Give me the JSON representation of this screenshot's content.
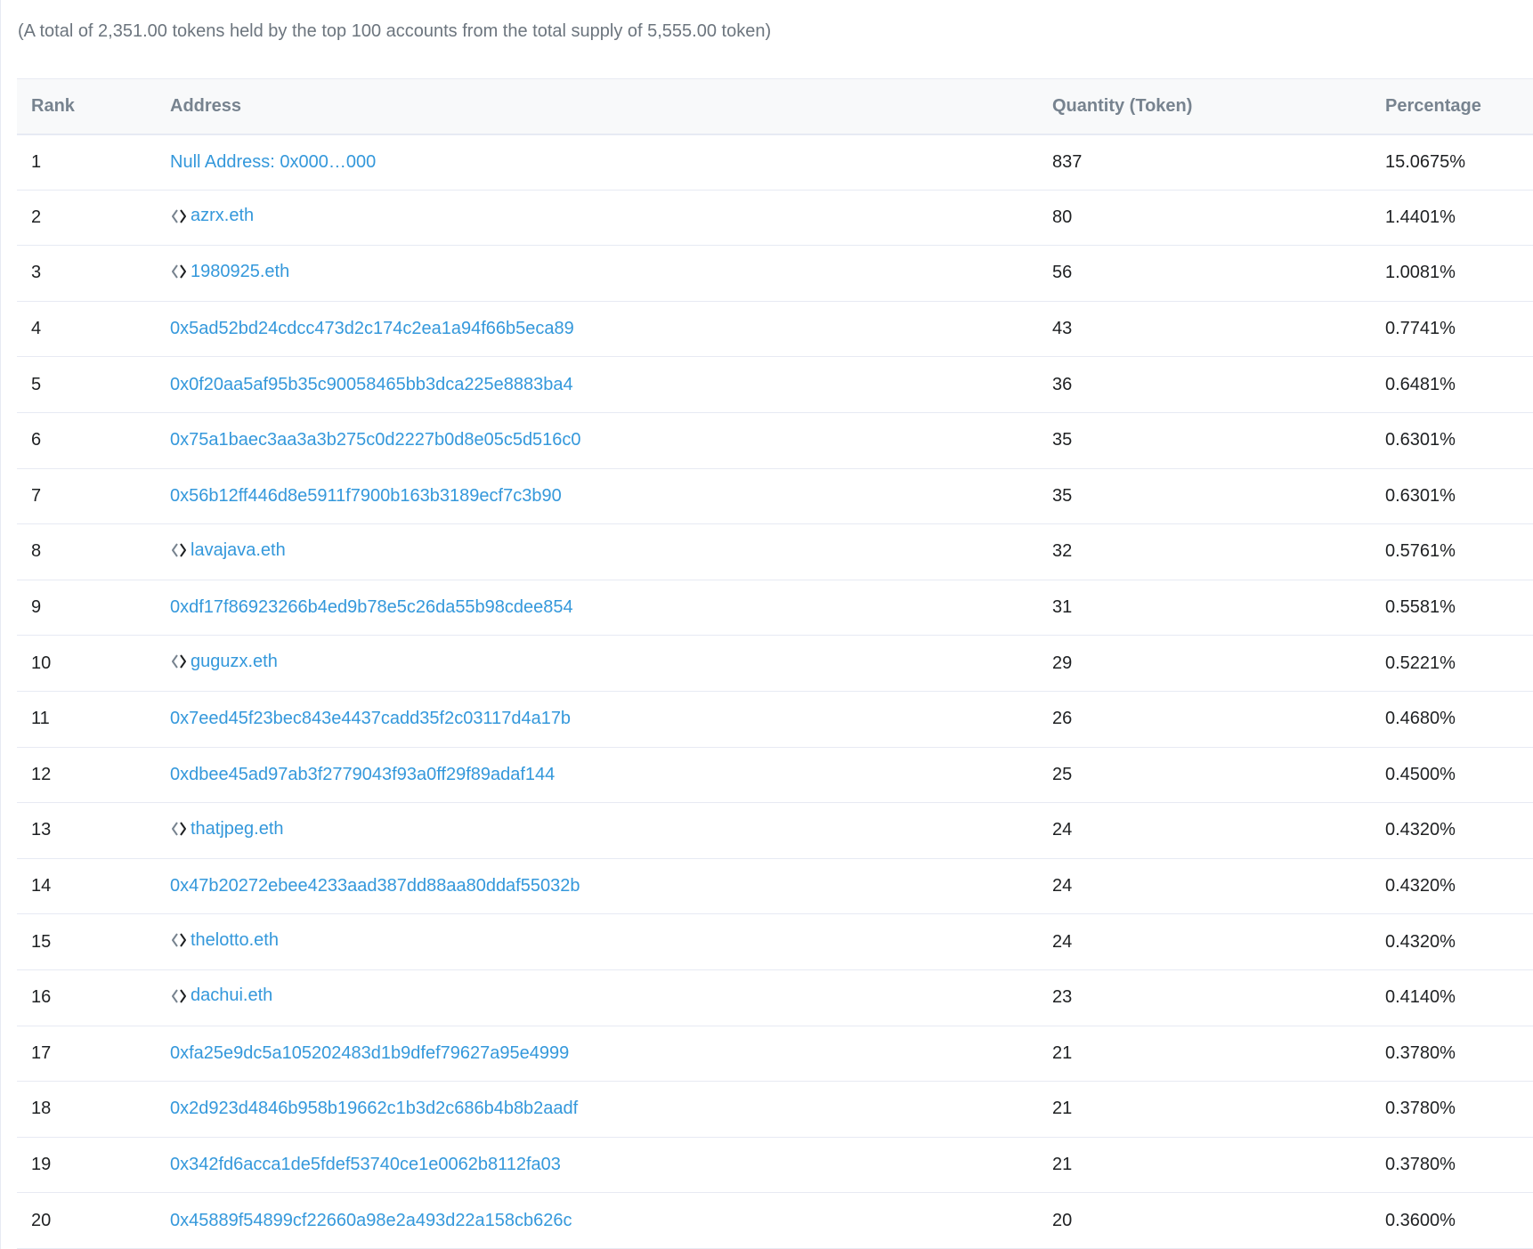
{
  "summary": "(A total of 2,351.00 tokens held by the top 100 accounts from the total supply of 5,555.00 token)",
  "table": {
    "headers": {
      "rank": "Rank",
      "address": "Address",
      "quantity": "Quantity (Token)",
      "percentage": "Percentage"
    },
    "rows": [
      {
        "rank": "1",
        "address": "Null Address: 0x000…000",
        "ens": false,
        "quantity": "837",
        "percentage": "15.0675%"
      },
      {
        "rank": "2",
        "address": "azrx.eth",
        "ens": true,
        "quantity": "80",
        "percentage": "1.4401%"
      },
      {
        "rank": "3",
        "address": "1980925.eth",
        "ens": true,
        "quantity": "56",
        "percentage": "1.0081%"
      },
      {
        "rank": "4",
        "address": "0x5ad52bd24cdcc473d2c174c2ea1a94f66b5eca89",
        "ens": false,
        "quantity": "43",
        "percentage": "0.7741%"
      },
      {
        "rank": "5",
        "address": "0x0f20aa5af95b35c90058465bb3dca225e8883ba4",
        "ens": false,
        "quantity": "36",
        "percentage": "0.6481%"
      },
      {
        "rank": "6",
        "address": "0x75a1baec3aa3a3b275c0d2227b0d8e05c5d516c0",
        "ens": false,
        "quantity": "35",
        "percentage": "0.6301%"
      },
      {
        "rank": "7",
        "address": "0x56b12ff446d8e5911f7900b163b3189ecf7c3b90",
        "ens": false,
        "quantity": "35",
        "percentage": "0.6301%"
      },
      {
        "rank": "8",
        "address": "lavajava.eth",
        "ens": true,
        "quantity": "32",
        "percentage": "0.5761%"
      },
      {
        "rank": "9",
        "address": "0xdf17f86923266b4ed9b78e5c26da55b98cdee854",
        "ens": false,
        "quantity": "31",
        "percentage": "0.5581%"
      },
      {
        "rank": "10",
        "address": "guguzx.eth",
        "ens": true,
        "quantity": "29",
        "percentage": "0.5221%"
      },
      {
        "rank": "11",
        "address": "0x7eed45f23bec843e4437cadd35f2c03117d4a17b",
        "ens": false,
        "quantity": "26",
        "percentage": "0.4680%"
      },
      {
        "rank": "12",
        "address": "0xdbee45ad97ab3f2779043f93a0ff29f89adaf144",
        "ens": false,
        "quantity": "25",
        "percentage": "0.4500%"
      },
      {
        "rank": "13",
        "address": "thatjpeg.eth",
        "ens": true,
        "quantity": "24",
        "percentage": "0.4320%"
      },
      {
        "rank": "14",
        "address": "0x47b20272ebee4233aad387dd88aa80ddaf55032b",
        "ens": false,
        "quantity": "24",
        "percentage": "0.4320%"
      },
      {
        "rank": "15",
        "address": "thelotto.eth",
        "ens": true,
        "quantity": "24",
        "percentage": "0.4320%"
      },
      {
        "rank": "16",
        "address": "dachui.eth",
        "ens": true,
        "quantity": "23",
        "percentage": "0.4140%"
      },
      {
        "rank": "17",
        "address": "0xfa25e9dc5a105202483d1b9dfef79627a95e4999",
        "ens": false,
        "quantity": "21",
        "percentage": "0.3780%"
      },
      {
        "rank": "18",
        "address": "0x2d923d4846b958b19662c1b3d2c686b4b8b2aadf",
        "ens": false,
        "quantity": "21",
        "percentage": "0.3780%"
      },
      {
        "rank": "19",
        "address": "0x342fd6acca1de5fdef53740ce1e0062b8112fa03",
        "ens": false,
        "quantity": "21",
        "percentage": "0.3780%"
      },
      {
        "rank": "20",
        "address": "0x45889f54899cf22660a98e2a493d22a158cb626c",
        "ens": false,
        "quantity": "20",
        "percentage": "0.3600%"
      }
    ]
  },
  "icons": {
    "ens": "ens-icon"
  },
  "colors": {
    "link": "#3498db",
    "text": "#1e2022",
    "muted": "#6c757e",
    "header_bg": "#f8f9fa",
    "border": "#e7eaf3"
  }
}
